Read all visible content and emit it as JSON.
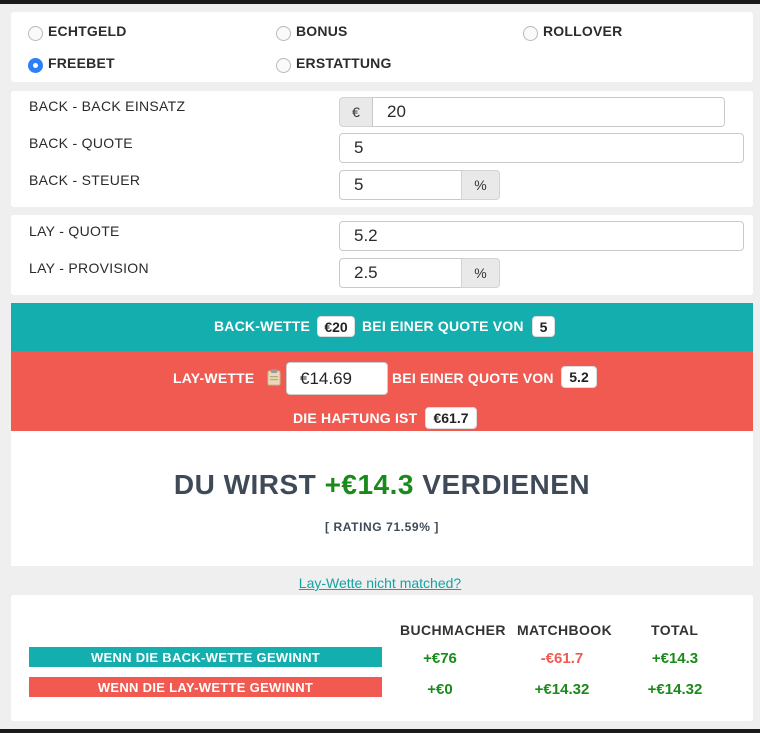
{
  "bet_type": {
    "options": [
      {
        "label": "ECHTGELD",
        "checked": false
      },
      {
        "label": "BONUS",
        "checked": false
      },
      {
        "label": "ROLLOVER",
        "checked": false
      },
      {
        "label": "FREEBET",
        "checked": true
      },
      {
        "label": "ERSTATTUNG",
        "checked": false
      }
    ]
  },
  "back": {
    "stake_label": "BACK - BACK EINSATZ",
    "stake_currency": "€",
    "stake_value": "20",
    "odds_label": "BACK - QUOTE",
    "odds_value": "5",
    "tax_label": "BACK - STEUER",
    "tax_value": "5",
    "tax_unit": "%"
  },
  "lay": {
    "odds_label": "LAY - QUOTE",
    "odds_value": "5.2",
    "commission_label": "LAY - PROVISION",
    "commission_value": "2.5",
    "commission_unit": "%"
  },
  "summary": {
    "back_prefix": "BACK-WETTE",
    "back_stake": "€20",
    "back_middle": "BEI EINER QUOTE VON",
    "back_odds": "5",
    "lay_prefix": "LAY-WETTE",
    "lay_stake": "€14.69",
    "lay_middle": "BEI EINER QUOTE VON",
    "lay_odds": "5.2",
    "liability_prefix": "DIE HAFTUNG IST",
    "liability": "€61.7",
    "color_back": "#14aeae",
    "color_lay": "#f05a51"
  },
  "result": {
    "prefix": "DU WIRST",
    "profit": "+€14.3",
    "suffix": "VERDIENEN",
    "rating": "[ RATING 71.59% ]"
  },
  "link_text": "Lay-Wette nicht matched?",
  "table": {
    "headers": [
      "BUCHMACHER",
      "MATCHBOOK",
      "TOTAL"
    ],
    "rows": [
      {
        "label": "WENN DIE BACK-WETTE GEWINNT",
        "values": [
          "+€76",
          "-€61.7",
          "+€14.3"
        ]
      },
      {
        "label": "WENN DIE LAY-WETTE GEWINNT",
        "values": [
          "+€0",
          "+€14.32",
          "+€14.32"
        ]
      }
    ]
  }
}
